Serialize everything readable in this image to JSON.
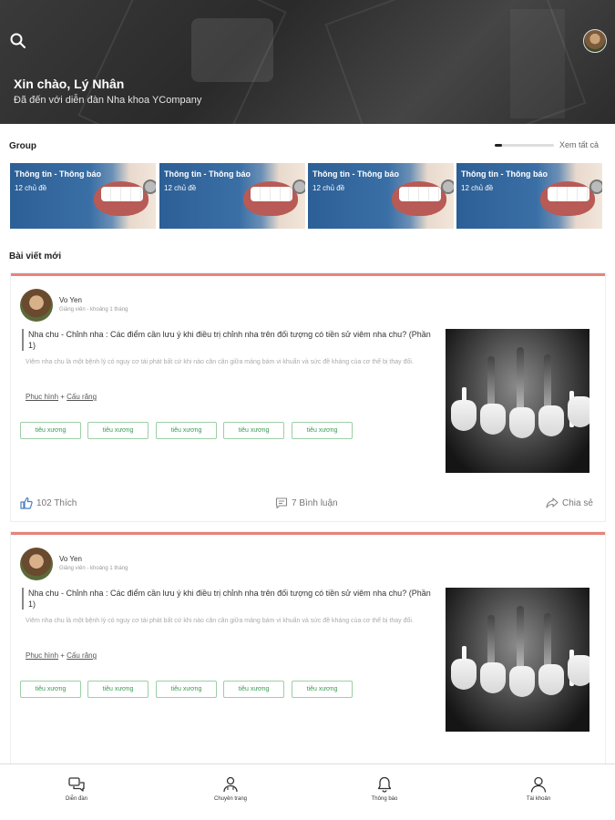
{
  "header": {
    "greeting": "Xin chào, Lý Nhân",
    "subtitle": "Đã đến với diễn đàn Nha khoa YCompany"
  },
  "groups": {
    "title": "Group",
    "see_all": "Xem tất cả",
    "scroll_progress": 0.12,
    "cards": [
      {
        "title": "Thông tin - Thông báo",
        "count": "12 chủ đề"
      },
      {
        "title": "Thông tin - Thông báo",
        "count": "12 chủ đề"
      },
      {
        "title": "Thông tin - Thông báo",
        "count": "12 chủ đề"
      },
      {
        "title": "Thông tin - Thông báo",
        "count": "12 chủ đề"
      }
    ]
  },
  "posts_section": {
    "title": "Bài viết mới"
  },
  "posts": [
    {
      "author": "Vo Yen",
      "meta": "Giảng viên - khoảng 1 tháng",
      "title": "Nha chu - Chỉnh nha : Các điểm cần lưu ý khi điều trị chỉnh nha trên đối tượng có tiền sử viêm nha chu? (Phần 1)",
      "excerpt": "Viêm nha chu là một bệnh lý có nguy cơ tái phát bất cứ khi nào cân cân giữa mảng bám vi khuẩn và sức đề kháng của cơ thể bị thay đổi.",
      "category_1": "Phục hình",
      "category_sep": " + ",
      "category_2": "Cấu răng",
      "tags": [
        "tiêu xương",
        "tiêu xương",
        "tiêu xương",
        "tiêu xương",
        "tiêu xương"
      ],
      "likes": "102 Thích",
      "comments": "7 Bình luận",
      "share": "Chia sẻ"
    },
    {
      "author": "Vo Yen",
      "meta": "Giảng viên - khoảng 1 tháng",
      "title": "Nha chu - Chỉnh nha : Các điểm cần lưu ý khi điều trị chỉnh nha trên đối tượng có tiền sử viêm nha chu? (Phần 1)",
      "excerpt": "Viêm nha chu là một bệnh lý có nguy cơ tái phát bất cứ khi nào cân cân giữa mảng bám vi khuẩn và sức đề kháng của cơ thể bị thay đổi.",
      "category_1": "Phục hình",
      "category_sep": " + ",
      "category_2": "Cấu răng",
      "tags": [
        "tiêu xương",
        "tiêu xương",
        "tiêu xương",
        "tiêu xương",
        "tiêu xương"
      ]
    }
  ],
  "bottom_nav": [
    {
      "label": "Diễn đàn",
      "icon": "forum-icon"
    },
    {
      "label": "Chuyên trang",
      "icon": "specialist-icon"
    },
    {
      "label": "Thông báo",
      "icon": "bell-icon"
    },
    {
      "label": "Tài khoản",
      "icon": "user-icon"
    }
  ],
  "colors": {
    "accent": "#e8827a",
    "tag_green": "#3a9a52",
    "group_blue": "#2c5f95"
  }
}
